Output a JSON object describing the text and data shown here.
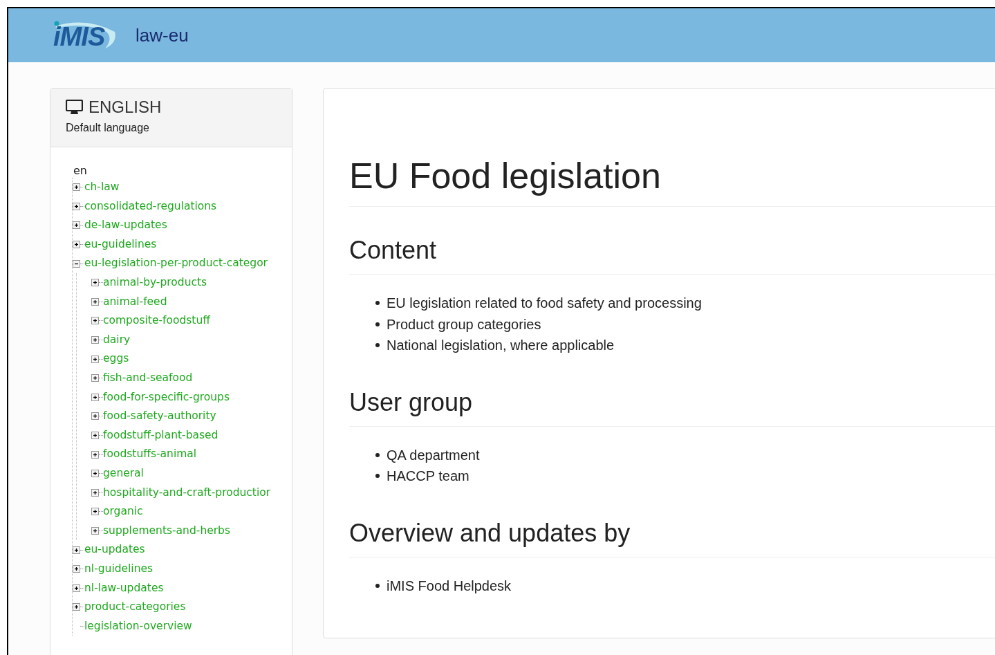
{
  "header": {
    "logo": "iMIS",
    "title": "law-eu"
  },
  "language_panel": {
    "title": "ENGLISH",
    "subtitle": "Default language"
  },
  "tree": {
    "root": "en",
    "items": [
      {
        "label": "ch-law",
        "kind": "folder",
        "expanded": false
      },
      {
        "label": "consolidated-regulations",
        "kind": "folder",
        "expanded": false
      },
      {
        "label": "de-law-updates",
        "kind": "folder",
        "expanded": false
      },
      {
        "label": "eu-guidelines",
        "kind": "folder",
        "expanded": false
      },
      {
        "label": "eu-legislation-per-product-categor",
        "kind": "folder",
        "expanded": true,
        "children": [
          {
            "label": "animal-by-products",
            "kind": "folder",
            "expanded": false
          },
          {
            "label": "animal-feed",
            "kind": "folder",
            "expanded": false
          },
          {
            "label": "composite-foodstuff",
            "kind": "folder",
            "expanded": false
          },
          {
            "label": "dairy",
            "kind": "folder",
            "expanded": false
          },
          {
            "label": "eggs",
            "kind": "folder",
            "expanded": false
          },
          {
            "label": "fish-and-seafood",
            "kind": "folder",
            "expanded": false
          },
          {
            "label": "food-for-specific-groups",
            "kind": "folder",
            "expanded": false
          },
          {
            "label": "food-safety-authority",
            "kind": "folder",
            "expanded": false
          },
          {
            "label": "foodstuff-plant-based",
            "kind": "folder",
            "expanded": false
          },
          {
            "label": "foodstuffs-animal",
            "kind": "folder",
            "expanded": false
          },
          {
            "label": "general",
            "kind": "folder",
            "expanded": false
          },
          {
            "label": "hospitality-and-craft-productior",
            "kind": "folder",
            "expanded": false
          },
          {
            "label": "organic",
            "kind": "folder",
            "expanded": false
          },
          {
            "label": "supplements-and-herbs",
            "kind": "folder",
            "expanded": false
          }
        ]
      },
      {
        "label": "eu-updates",
        "kind": "folder",
        "expanded": false
      },
      {
        "label": "nl-guidelines",
        "kind": "folder",
        "expanded": false
      },
      {
        "label": "nl-law-updates",
        "kind": "folder",
        "expanded": false
      },
      {
        "label": "product-categories",
        "kind": "folder",
        "expanded": false
      },
      {
        "label": "legislation-overview",
        "kind": "leaf"
      }
    ]
  },
  "content": {
    "title": "EU Food legislation",
    "sections": [
      {
        "heading": "Content",
        "bullets": [
          "EU legislation related to food safety and processing",
          "Product group categories",
          "National legislation, where applicable"
        ]
      },
      {
        "heading": "User group",
        "bullets": [
          "QA department",
          "HACCP team"
        ]
      },
      {
        "heading": "Overview and updates by",
        "bullets": [
          "iMIS Food Helpdesk"
        ]
      }
    ]
  }
}
